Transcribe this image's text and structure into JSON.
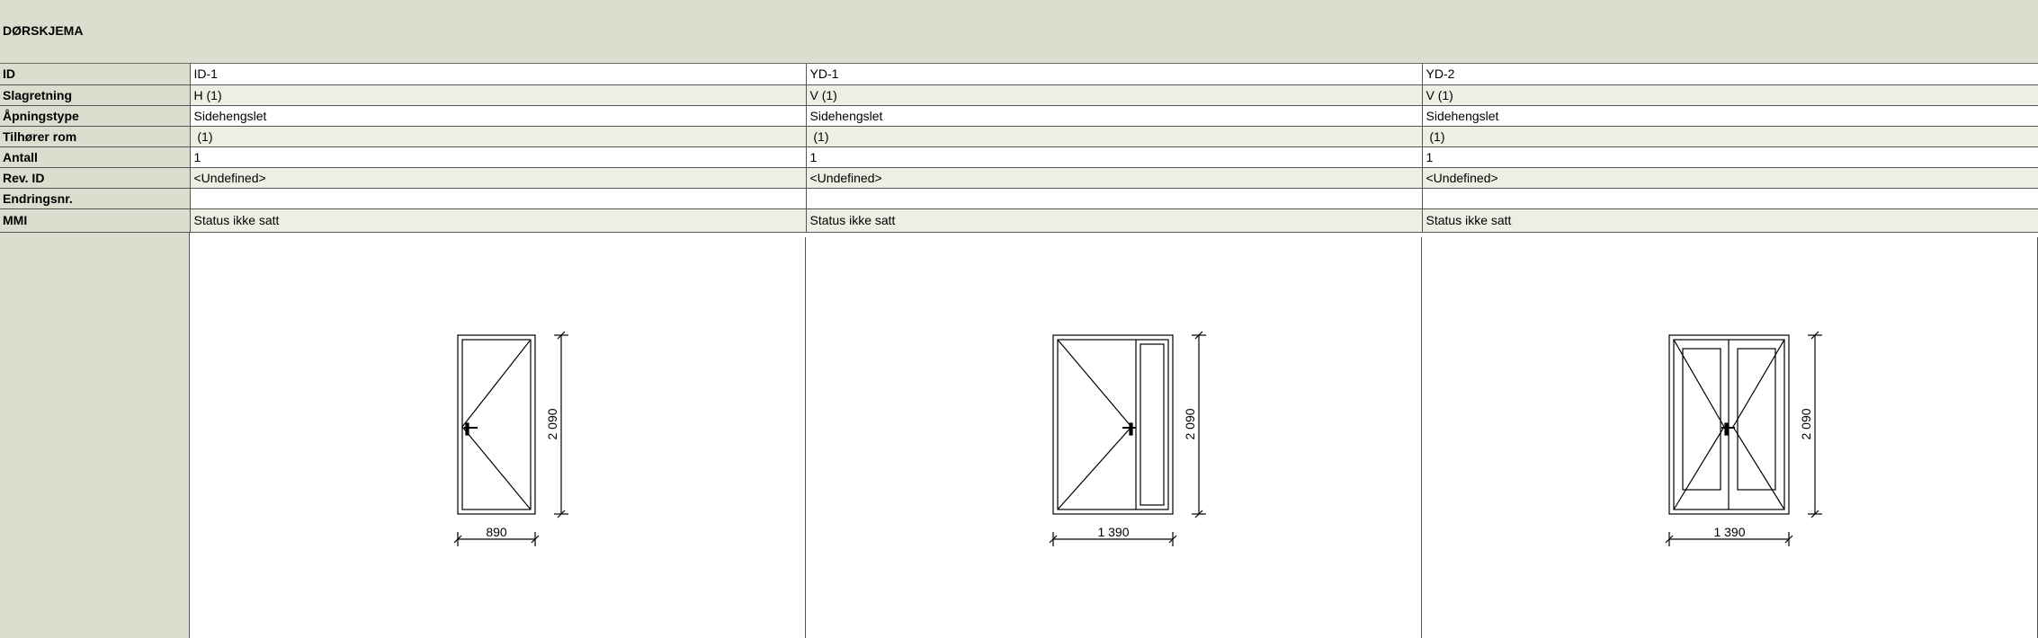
{
  "schedule": {
    "title": "DØRSKJEMA",
    "labels": {
      "id": "ID",
      "swing": "Slagretning",
      "opening_type": "Åpningstype",
      "room": "Tilhører rom",
      "count": "Antall",
      "rev_id": "Rev. ID",
      "change_no": "Endringsnr.",
      "mmi": "MMI"
    },
    "doors": [
      {
        "id": "ID-1",
        "swing": "H (1)",
        "opening_type": "Sidehengslet",
        "room": " (1)",
        "count": "1",
        "rev_id": "<Undefined>",
        "change_no": "",
        "mmi": "Status ikke satt",
        "width_dim": "890",
        "height_dim": "2 090",
        "drawing": "single-door-icon"
      },
      {
        "id": "YD-1",
        "swing": "V (1)",
        "opening_type": "Sidehengslet",
        "room": " (1)",
        "count": "1",
        "rev_id": "<Undefined>",
        "change_no": "",
        "mmi": "Status ikke satt",
        "width_dim": "1 390",
        "height_dim": "2 090",
        "drawing": "door-with-sidelight-icon"
      },
      {
        "id": "YD-2",
        "swing": "V (1)",
        "opening_type": "Sidehengslet",
        "room": " (1)",
        "count": "1",
        "rev_id": "<Undefined>",
        "change_no": "",
        "mmi": "Status ikke satt",
        "width_dim": "1 390",
        "height_dim": "2 090",
        "drawing": "double-door-icon"
      }
    ]
  }
}
